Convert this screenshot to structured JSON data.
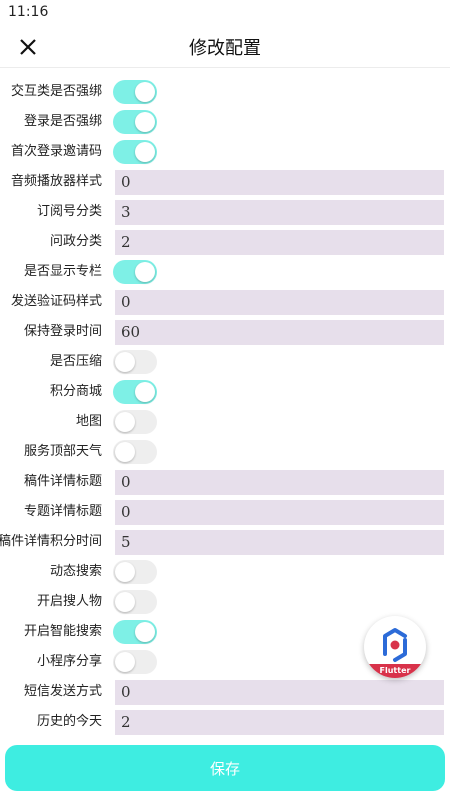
{
  "status_bar": {
    "time": "11:16"
  },
  "header": {
    "title": "修改配置",
    "close_icon": "close-icon"
  },
  "colors": {
    "switch_on": "#7ef0e6",
    "switch_off": "#eeeeee",
    "field_bg": "#e7dfeb",
    "save_button": "#3eede1"
  },
  "rows": [
    {
      "label": "交互类是否强绑",
      "type": "switch",
      "on": true
    },
    {
      "label": "登录是否强绑",
      "type": "switch",
      "on": true
    },
    {
      "label": "首次登录邀请码",
      "type": "switch",
      "on": true
    },
    {
      "label": "音频播放器样式",
      "type": "text",
      "value": "0"
    },
    {
      "label": "订阅号分类",
      "type": "text",
      "value": "3"
    },
    {
      "label": "问政分类",
      "type": "text",
      "value": "2"
    },
    {
      "label": "是否显示专栏",
      "type": "switch",
      "on": true
    },
    {
      "label": "发送验证码样式",
      "type": "text",
      "value": "0"
    },
    {
      "label": "保持登录时间",
      "type": "text",
      "value": "60"
    },
    {
      "label": "是否压缩",
      "type": "switch",
      "on": false
    },
    {
      "label": "积分商城",
      "type": "switch",
      "on": true
    },
    {
      "label": "地图",
      "type": "switch",
      "on": false
    },
    {
      "label": "服务顶部天气",
      "type": "switch",
      "on": false
    },
    {
      "label": "稿件详情标题",
      "type": "text",
      "value": "0"
    },
    {
      "label": "专题详情标题",
      "type": "text",
      "value": "0"
    },
    {
      "label": "稿件详情积分时间",
      "type": "text",
      "value": "5"
    },
    {
      "label": "动态搜索",
      "type": "switch",
      "on": false
    },
    {
      "label": "开启搜人物",
      "type": "switch",
      "on": false
    },
    {
      "label": "开启智能搜索",
      "type": "switch",
      "on": true
    },
    {
      "label": "小程序分享",
      "type": "switch",
      "on": false
    },
    {
      "label": "短信发送方式",
      "type": "text",
      "value": "0"
    },
    {
      "label": "历史的今天",
      "type": "text",
      "value": "2"
    }
  ],
  "floating_badge": {
    "label": "Flutter",
    "icon": "flutter-inspector-icon"
  },
  "footer": {
    "save_label": "保存"
  }
}
